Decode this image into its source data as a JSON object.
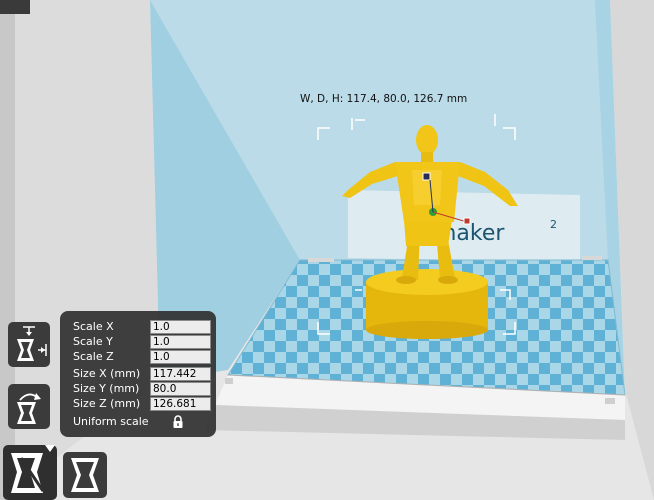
{
  "viewport": {
    "dimensions_label": "W, D, H: 117.4, 80.0, 126.7 mm",
    "logo_text": "maker",
    "logo_sup": "2",
    "colors": {
      "back_wall": "#b9dbe7",
      "side_wall": "#9fcfe2",
      "grid_light": "#aad6e6",
      "grid_dark": "#5fb3d6",
      "model": "#f1c40f"
    }
  },
  "scale_panel": {
    "rows": [
      {
        "label": "Scale X",
        "value": "1.0"
      },
      {
        "label": "Scale Y",
        "value": "1.0"
      },
      {
        "label": "Scale Z",
        "value": "1.0"
      },
      {
        "label": "Size X (mm)",
        "value": "117.442"
      },
      {
        "label": "Size Y (mm)",
        "value": "80.0"
      },
      {
        "label": "Size Z (mm)",
        "value": "126.681"
      }
    ],
    "uniform_scale_label": "Uniform scale",
    "lock_icon": "lock-icon"
  },
  "toolbar": {
    "icons": [
      "scale-to-max-icon",
      "reset-scale-icon",
      "scale-tool-icon",
      "mirror-tool-icon"
    ]
  }
}
